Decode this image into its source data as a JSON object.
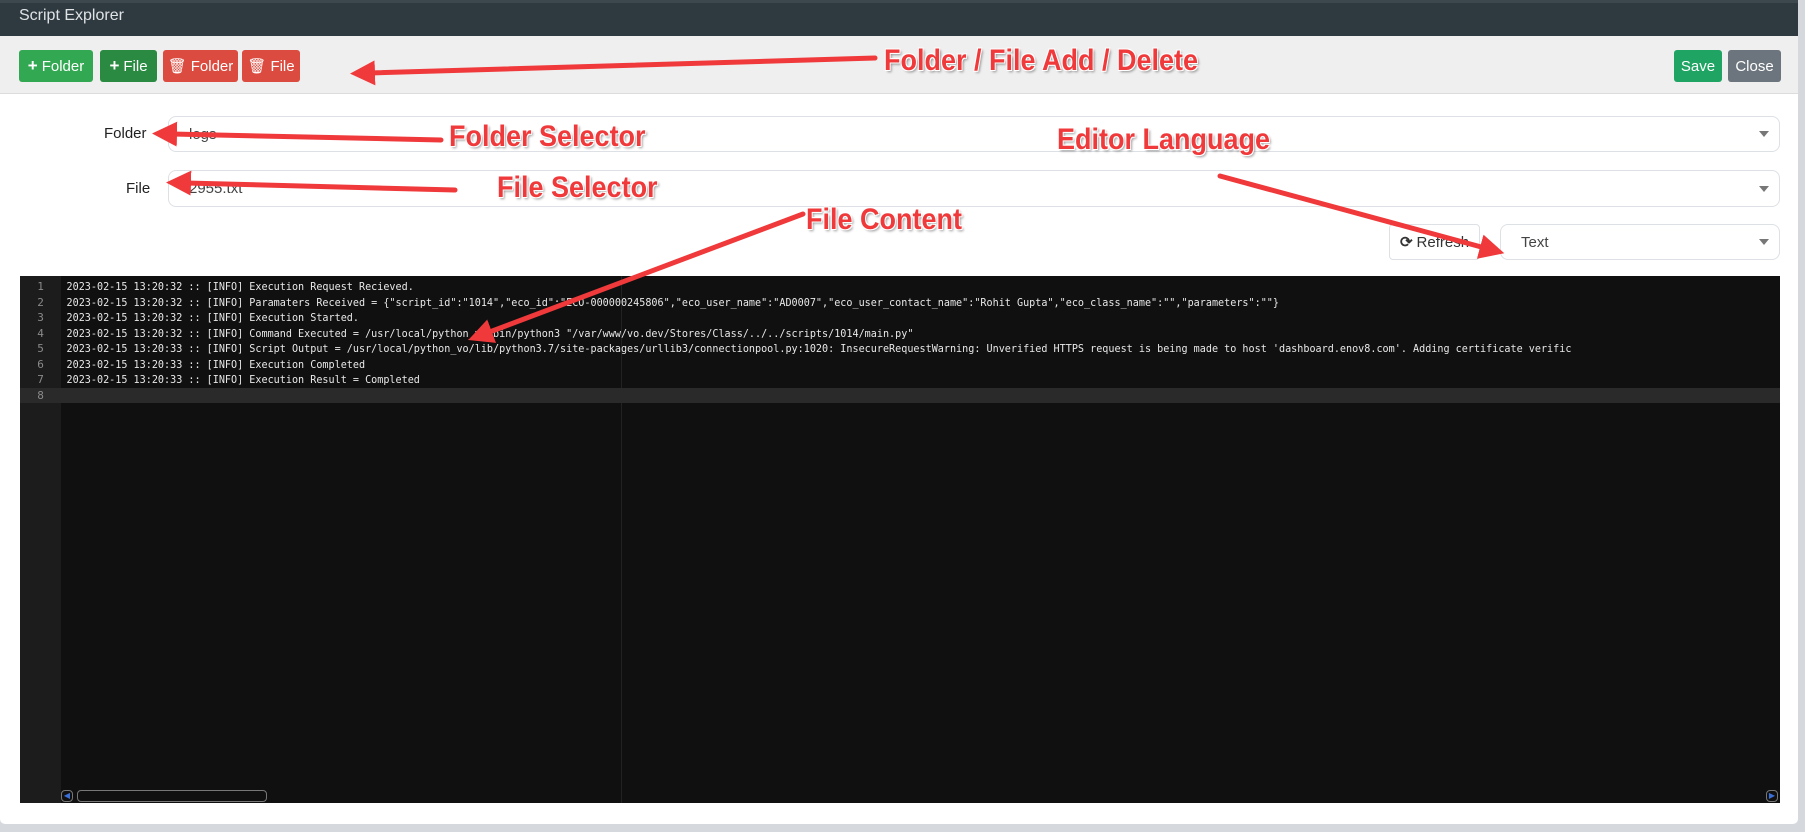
{
  "window": {
    "title": "Script Explorer"
  },
  "toolbar": {
    "add_folder": "Folder",
    "add_file": "File",
    "delete_folder": "Folder",
    "delete_file": "File",
    "save": "Save",
    "close": "Close"
  },
  "form": {
    "folder_label": "Folder",
    "folder_value": "logs",
    "file_label": "File",
    "file_value": "2955.txt",
    "refresh_label": "Refresh",
    "language_value": "Text"
  },
  "editor": {
    "lines": [
      "2023-02-15 13:20:32 :: [INFO] Execution Request Recieved.",
      "2023-02-15 13:20:32 :: [INFO] Paramaters Received = {\"script_id\":\"1014\",\"eco_id\":\"ECO-000000245806\",\"eco_user_name\":\"AD0007\",\"eco_user_contact_name\":\"Rohit Gupta\",\"eco_class_name\":\"\",\"parameters\":\"\"}",
      "2023-02-15 13:20:32 :: [INFO] Execution Started.",
      "2023-02-15 13:20:32 :: [INFO] Command Executed = /usr/local/python_vo/bin/python3 \"/var/www/vo.dev/Stores/Class/../../scripts/1014/main.py\"",
      "2023-02-15 13:20:33 :: [INFO] Script Output = /usr/local/python_vo/lib/python3.7/site-packages/urllib3/connectionpool.py:1020: InsecureRequestWarning: Unverified HTTPS request is being made to host 'dashboard.enov8.com'. Adding certificate verific",
      "2023-02-15 13:20:33 :: [INFO] Execution Completed",
      "2023-02-15 13:20:33 :: [INFO] Execution Result = Completed",
      ""
    ]
  },
  "annotations": {
    "toolbar": "Folder / File Add / Delete",
    "folder": "Folder Selector",
    "file": "File Selector",
    "language": "Editor Language",
    "content": "File Content"
  },
  "colors": {
    "accent_green": "#33a852",
    "danger_red": "#db4b3f",
    "annotation_red": "#f0393a",
    "titlebar": "#2f3a40"
  }
}
